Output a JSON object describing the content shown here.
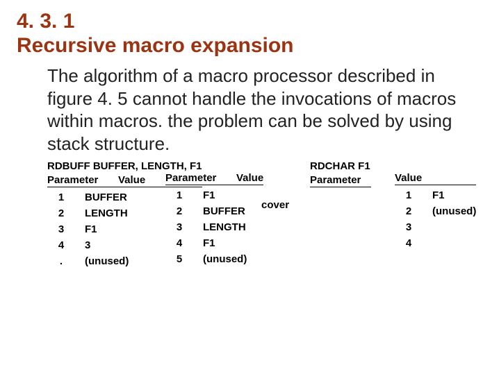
{
  "heading_num": "4. 3. 1",
  "heading_title": "Recursive macro expansion",
  "body": "The algorithm of a macro processor described in figure 4. 5 cannot handle the invocations of macros within macros. the problem can be solved by using stack structure.",
  "inv1": "RDBUFF  BUFFER, LENGTH, F1",
  "inv2": "RDCHAR  F1",
  "col_param": "Parameter",
  "col_value": "Value",
  "cover_label": "cover",
  "t1": {
    "r1c1": "1",
    "r1c2": "BUFFER",
    "r2c1": "2",
    "r2c2": "LENGTH",
    "r3c1": "3",
    "r3c2": "F1",
    "r4c1": "4",
    "r4c2": "3",
    "r5c1": ".",
    "r5c2": "(unused)"
  },
  "t2": {
    "r1c1": "1",
    "r1c2": "F1",
    "r2c1": "2",
    "r2c2": "BUFFER",
    "r3c1": "3",
    "r3c2": "LENGTH",
    "r4c1": "4",
    "r4c2": "F1",
    "r5c1": "5",
    "r5c2": "(unused)"
  },
  "t4": {
    "r1c1": "1",
    "r1c2": "F1",
    "r2c1": "2",
    "r2c2": "(unused)",
    "r3c1": "3",
    "r4c1": "4"
  }
}
